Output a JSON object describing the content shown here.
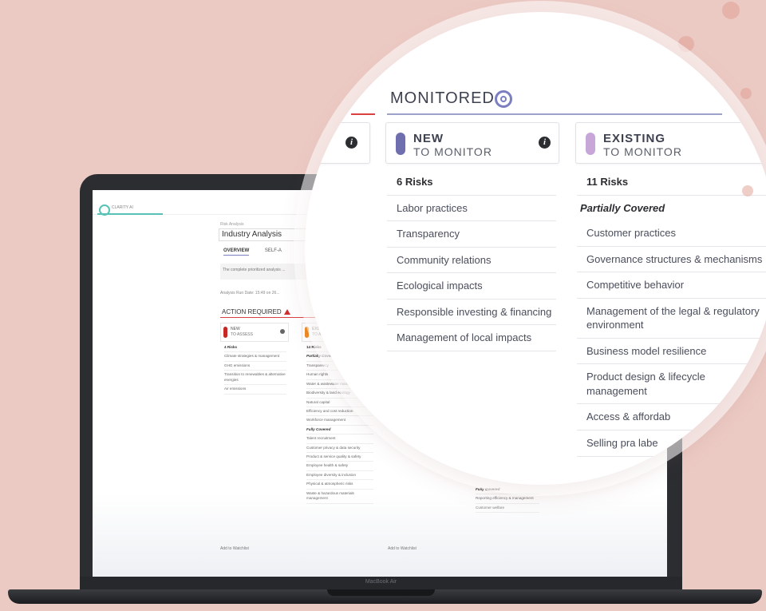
{
  "screen": {
    "app_logo_text": "CLARITY AI",
    "breadcrumb": "Risk Analysis",
    "title": "Industry Analysis",
    "tabs": [
      "OVERVIEW",
      "SELF-A"
    ],
    "description": "The complete prioritized analysis ...",
    "analysis_date": "Analysis Run Date: 15:49 on 26...",
    "action_required": "ACTION REQUIRED",
    "card1": {
      "line1": "NEW",
      "line2": "TO ASSESS"
    },
    "card2": {
      "line1": "EXISTING",
      "line2": "TO ASSESS"
    },
    "col1": [
      "4 Risks",
      "Climate strategies & management",
      "GHG emissions",
      "Transition to renewables & alternative energies",
      "Air emissions"
    ],
    "col2_head": "14 Risks",
    "col2_sub1": "Partially Covered",
    "col2": [
      "Transparency",
      "Human rights",
      "Water & wastewater management",
      "Biodiversity & land ecology",
      "Natural capital",
      "Efficiency and cost reduction",
      "Workforce management"
    ],
    "col2_sub2": "Fully Covered",
    "col2b": [
      "Talent recruitment",
      "Customer privacy & data security",
      "Product & service quality & safety",
      "Employee health & safety",
      "Employee diversity & inclusion",
      "Physical & atmospheric risks",
      "Waste & hazardous materials management"
    ],
    "col3_sub": "Fully Covered",
    "col3": [
      "Reporting efficiency & management",
      "Customer welfare"
    ],
    "link1": "Add to Watchlist",
    "link2": "Add to Watchlist",
    "laptop_brand": "MacBook Air"
  },
  "magnifier": {
    "section_title": "MONITORED",
    "new_card": {
      "line1": "NEW",
      "line2": "TO MONITOR",
      "color": "#6f6fb0"
    },
    "existing_card": {
      "line1": "EXISTING",
      "line2": "TO MONITOR",
      "color": "#c7a6d8"
    },
    "new_count": "6 Risks",
    "new_risks": [
      "Labor practices",
      "Transparency",
      "Community relations",
      "Ecological impacts",
      "Responsible investing & financing",
      "Management of local impacts"
    ],
    "existing_count": "11 Risks",
    "existing_sub": "Partially Covered",
    "existing_risks": [
      "Customer practices",
      "Governance structures & mechanisms",
      "Competitive behavior",
      "Management of the legal & regulatory environment",
      "Business model resilience",
      "Product design & lifecycle management",
      "Access & affordab",
      "Selling pra labe"
    ]
  },
  "colors": {
    "accent": "#7b7fc1",
    "alert": "#d94040",
    "background": "#eccac4"
  }
}
